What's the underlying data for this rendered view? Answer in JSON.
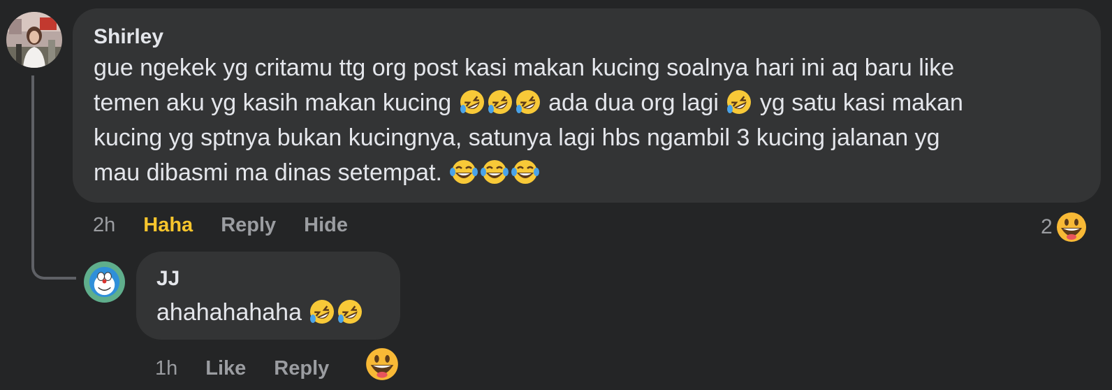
{
  "comments": [
    {
      "author": "Shirley",
      "avatar_icon": "user-photo-avatar",
      "text_line1": "gue ngekek yg critamu ttg org post kasi makan kucing soalnya hari ini aq baru like",
      "text_line2a": "temen aku yg kasih makan kucing",
      "text_line2b": "ada dua org lagi",
      "text_line2c": "yg satu kasi makan",
      "text_line3": "kucing yg sptnya bukan kucingnya, satunya lagi hbs ngambil 3 kucing jalanan yg",
      "text_line4": "mau dibasmi ma dinas setempat.",
      "time": "2h",
      "reaction_label": "Haha",
      "reply_label": "Reply",
      "hide_label": "Hide",
      "reaction_count": "2",
      "reaction_icon": "grinning-face-icon"
    },
    {
      "author": "JJ",
      "avatar_icon": "doraemon-avatar",
      "text": "ahahahahaha",
      "time": "1h",
      "like_label": "Like",
      "reply_label": "Reply",
      "reaction_icon": "grinning-face-icon"
    }
  ],
  "colors": {
    "background": "#242526",
    "bubble": "#333435",
    "text": "#e4e6eb",
    "secondary_text": "#9b9da1",
    "haha_active": "#f7c52d",
    "thread_line": "#5f6166"
  }
}
